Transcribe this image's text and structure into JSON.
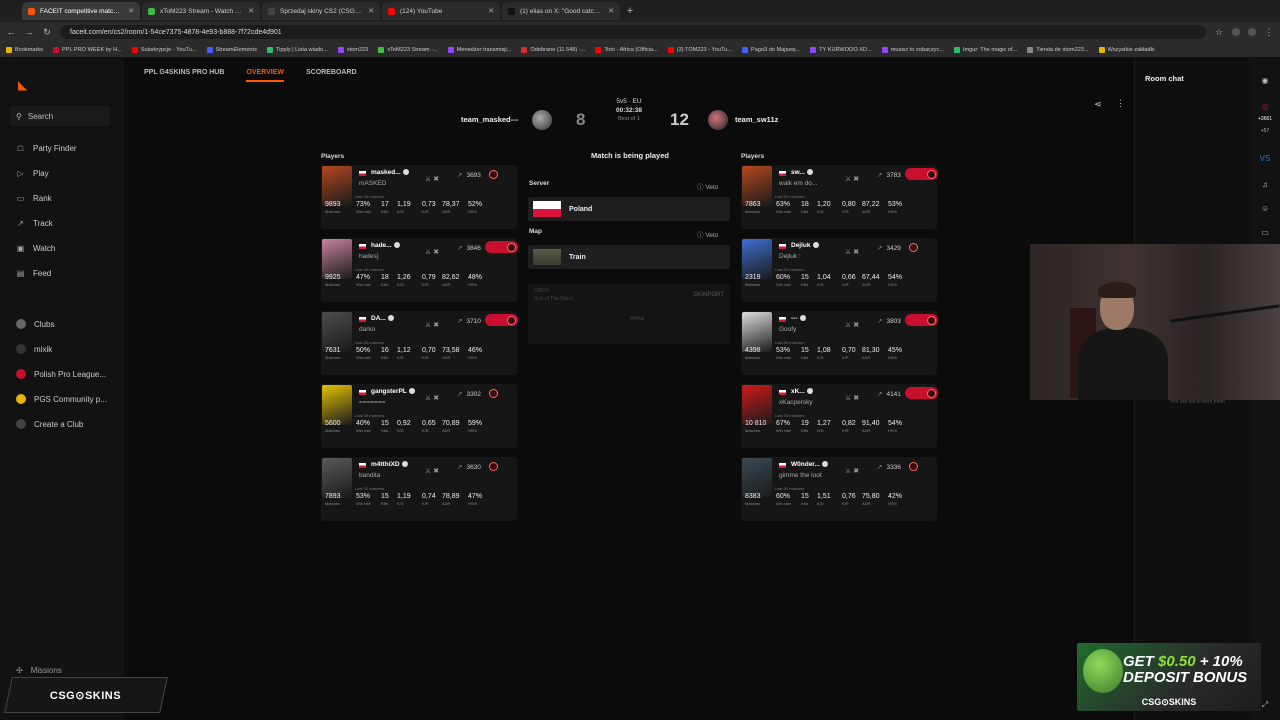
{
  "browser": {
    "tabs": [
      {
        "title": "FACEIT competitive match - FA",
        "color": "#ff5500",
        "active": true
      },
      {
        "title": "xToM223 Stream - Watch Live o",
        "color": "#3fbf3f",
        "active": false
      },
      {
        "title": "Sprzedaj skiny CS2 (CSGO) | N",
        "color": "#444444",
        "active": false
      },
      {
        "title": "(124) YouTube",
        "color": "#ff0000",
        "active": false
      },
      {
        "title": "(1) elias on X: \"Good catch @e",
        "color": "#111111",
        "active": false
      }
    ],
    "url": "faceit.com/en/cs2/room/1-54ce7375-4878-4e93-b888-7f72cde4d901",
    "bookmarks": [
      {
        "label": "Bookmarks",
        "color": "#e5b700"
      },
      {
        "label": "PPL PRO WEEK by H...",
        "color": "#c8102e"
      },
      {
        "label": "Subskrypcje - YouTu...",
        "color": "#ff0000"
      },
      {
        "label": "StreamElements",
        "color": "#4b5cff"
      },
      {
        "label": "Tipply | Lista wiado...",
        "color": "#2bbf6a"
      },
      {
        "label": "xtom223",
        "color": "#9146ff"
      },
      {
        "label": "xToM223 Stream -...",
        "color": "#3fbf3f"
      },
      {
        "label": "Menedżer transmisji...",
        "color": "#9146ff"
      },
      {
        "label": "Odebrane (11 548) -...",
        "color": "#d93025"
      },
      {
        "label": "Toto - Africa (Officia...",
        "color": "#ff0000"
      },
      {
        "label": "(3) TOM223 - YouTu...",
        "color": "#ff0000"
      },
      {
        "label": "Pago3 do Majszej...",
        "color": "#4b5cff"
      },
      {
        "label": "TY KURWOOO XD...",
        "color": "#9146ff"
      },
      {
        "label": "musisz to zobaczyc...",
        "color": "#9146ff"
      },
      {
        "label": "Imgur: The magic of...",
        "color": "#2bbf6a"
      },
      {
        "label": "Tienda de xtom223...",
        "color": "#888888"
      },
      {
        "label": "Wszystkie zakładki",
        "color": "#e5b700"
      }
    ]
  },
  "nav": {
    "search": "Search",
    "items": [
      {
        "label": "Party Finder",
        "icon": "party-icon",
        "glyph": "☖"
      },
      {
        "label": "Play",
        "icon": "play-icon",
        "glyph": "▷"
      },
      {
        "label": "Rank",
        "icon": "rank-icon",
        "glyph": "▭"
      },
      {
        "label": "Track",
        "icon": "track-icon",
        "glyph": "↗"
      },
      {
        "label": "Watch",
        "icon": "watch-icon",
        "glyph": "▣"
      },
      {
        "label": "Feed",
        "icon": "feed-icon",
        "glyph": "▤"
      }
    ],
    "clubs": [
      {
        "label": "Clubs",
        "icon": "clubs-icon",
        "color": "#666666"
      },
      {
        "label": "mixik",
        "icon": "mixik-avatar",
        "color": "#333333"
      },
      {
        "label": "Polish Pro League...",
        "icon": "ppl-avatar",
        "color": "#c8102e"
      },
      {
        "label": "PGS Community p...",
        "icon": "pgs-avatar",
        "color": "#e5b700"
      },
      {
        "label": "Create a Club",
        "icon": "plus-icon",
        "color": "#444444"
      }
    ],
    "missions": "Missions",
    "sponsor": "CSG⊙SKINS"
  },
  "subnav": {
    "hub": "PPL G4SKINS PRO HUB",
    "overview": "OVERVIEW",
    "scoreboard": "SCOREBOARD"
  },
  "match": {
    "team1": "team_masked---",
    "team2": "team_sw11z",
    "score1": "8",
    "score2": "12",
    "mode": "5v5 · EU",
    "time": "00:32:38",
    "bestof": "Best of 1",
    "status": "Match is being played",
    "players_label": "Players",
    "server_label": "Server",
    "server": "Poland",
    "map_label": "Map",
    "map": "Train",
    "veto": "Veto",
    "ad_l1": "DMVIX",
    "ad_l2": "Gun of The Match",
    "ad_l3": "SKINPORT",
    "ad_l4": "MAAA"
  },
  "stat_labels": [
    "Matches",
    "Win rate",
    "Kills",
    "K/D",
    "K/R",
    "ADR",
    "HS%"
  ],
  "last30": "Last 30 matches",
  "team1_players": [
    {
      "name": "masked...",
      "sub": "mASKED",
      "elo": "3693",
      "level_color": "#c8102e",
      "avatar": "#b5471f",
      "stats": [
        "9893",
        "73%",
        "17",
        "1,19",
        "0,73",
        "78,37",
        "52%"
      ]
    },
    {
      "name": "hade...",
      "sub": "hades]",
      "elo": "3846",
      "level_color": "#c8102e",
      "avatar": "#c9839f",
      "stats": [
        "9925",
        "47%",
        "18",
        "1,26",
        "0,79",
        "82,62",
        "48%"
      ]
    },
    {
      "name": "DA...",
      "sub": "darko",
      "elo": "3710",
      "level_color": "#c8102e",
      "avatar": "#4d4d4d",
      "stats": [
        "7631",
        "50%",
        "16",
        "1,12",
        "0,70",
        "73,58",
        "46%"
      ]
    },
    {
      "name": "gangsterPL",
      "sub": "=======",
      "elo": "3302",
      "level_color": "#c8102e",
      "avatar": "#e5c200",
      "stats": [
        "5600",
        "40%",
        "15",
        "0,92",
        "0,65",
        "70,89",
        "59%"
      ]
    },
    {
      "name": "m4tthiXD",
      "sub": "bandita",
      "elo": "3630",
      "level_color": "#c8102e",
      "avatar": "#5a5a5a",
      "stats": [
        "7893",
        "53%",
        "15",
        "1,19",
        "0,74",
        "78,89",
        "47%"
      ]
    }
  ],
  "team2_players": [
    {
      "name": "sw...",
      "sub": "walk em do...",
      "elo": "3783",
      "level_color": "#c8102e",
      "avatar": "#b5471f",
      "stats": [
        "7863",
        "63%",
        "18",
        "1,20",
        "0,80",
        "87,22",
        "53%"
      ]
    },
    {
      "name": "Dejluk",
      "sub": "Dejluk :",
      "elo": "3429",
      "level_color": "#c8102e",
      "avatar": "#3d6fd1",
      "stats": [
        "2319",
        "60%",
        "15",
        "1,04",
        "0,66",
        "67,44",
        "54%"
      ]
    },
    {
      "name": "---",
      "sub": "Goofy",
      "elo": "3803",
      "level_color": "#c8102e",
      "avatar": "#dddddd",
      "stats": [
        "4398",
        "53%",
        "15",
        "1,08",
        "0,70",
        "81,30",
        "45%"
      ]
    },
    {
      "name": "xK...",
      "sub": "xKacpersky",
      "elo": "4141",
      "level_color": "#c8102e",
      "avatar": "#d01a1a",
      "stats": [
        "10 810",
        "67%",
        "19",
        "1,27",
        "0,82",
        "91,40",
        "54%"
      ]
    },
    {
      "name": "W0nder...",
      "sub": "gimme the loot",
      "elo": "3336",
      "level_color": "#c8102e",
      "avatar": "#3a4a55",
      "stats": [
        "8383",
        "60%",
        "15",
        "1,51",
        "0,76",
        "75,80",
        "42%"
      ]
    }
  ],
  "chat": {
    "title": "Room chat",
    "ghost": "You are not a room mem"
  },
  "rightbar": {
    "count1": "+3661",
    "count2": "+57"
  },
  "ad": {
    "line1_a": "GET ",
    "line1_b": "$0.50",
    "line1_c": " + 10%",
    "line2": "DEPOSIT BONUS",
    "brand": "CSG⊙SKINS"
  }
}
